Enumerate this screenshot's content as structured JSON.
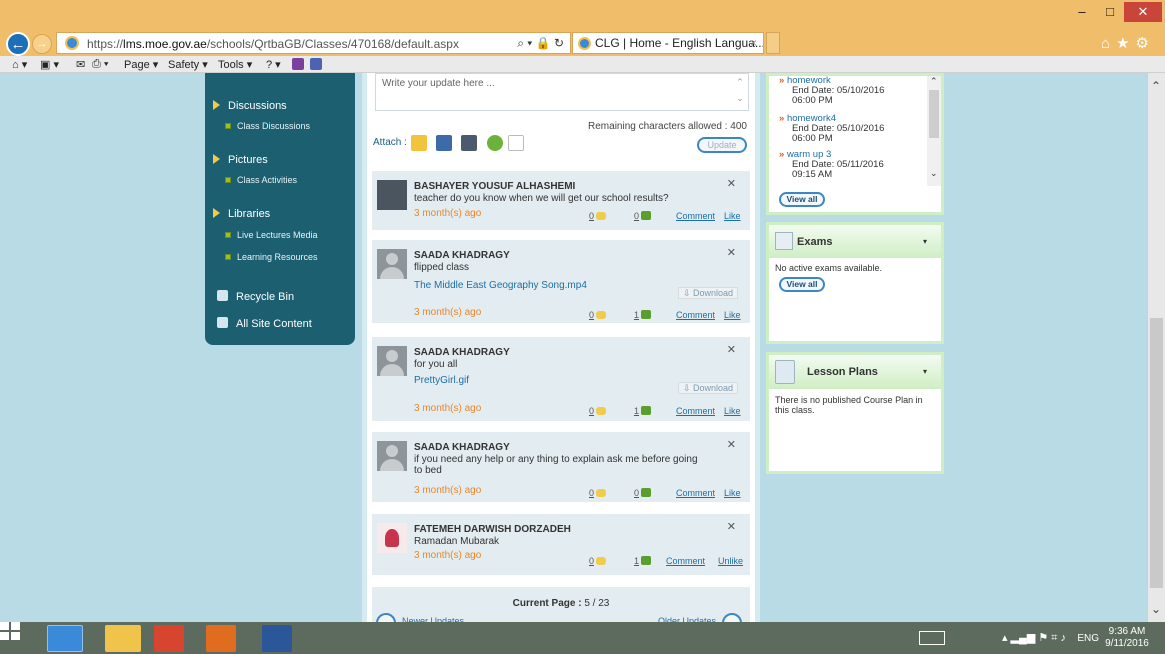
{
  "browser": {
    "url_prefix": "https://",
    "url_domain": "lms.moe.gov.ae",
    "url_path": "/schools/QrtbaGB/Classes/470168/default.aspx",
    "address_tools": "⌕ ▾ 🔒 ↻",
    "tab_title": "CLG | Home - English Langua...",
    "tab_close": "×",
    "win_min": "–",
    "win_max": "□",
    "win_close": "✕",
    "right_icons": "⌂★⚙"
  },
  "commandbar": {
    "home": "⌂ ▾",
    "feeds": "▣ ▾",
    "mail": "✉",
    "print": "⎙ ▾",
    "page": "Page ▾",
    "safety": "Safety ▾",
    "tools": "Tools ▾",
    "help": "? ▾"
  },
  "leftnav": {
    "discussions": "Discussions",
    "class_discussions": "Class Discussions",
    "pictures": "Pictures",
    "class_activities": "Class Activities",
    "libraries": "Libraries",
    "live_lectures": "Live Lectures Media",
    "learning_resources": "Learning Resources",
    "recycle_bin": "Recycle Bin",
    "all_site_content": "All Site Content"
  },
  "composer": {
    "placeholder": "Write your update here ...",
    "remaining": "Remaining characters allowed : 400",
    "attach_label": "Attach :",
    "update_button": "Update"
  },
  "posts": [
    {
      "name": "BASHAYER YOUSUF ALHASHEMI",
      "message": "teacher do you know when we will get our school results?",
      "time": "3 month(s) ago",
      "comments": "0",
      "likes": "0",
      "comment_label": "Comment",
      "like_label": "Like"
    },
    {
      "name": "SAADA KHADRAGY",
      "message": "flipped class",
      "file": "The Middle East Geography Song.mp4",
      "download": "⇩ Download",
      "time": "3 month(s) ago",
      "comments": "0",
      "likes": "1",
      "comment_label": "Comment",
      "like_label": "Like"
    },
    {
      "name": "SAADA KHADRAGY",
      "message": "for you all",
      "file": "PrettyGirl.gif",
      "download": "⇩ Download",
      "time": "3 month(s) ago",
      "comments": "0",
      "likes": "1",
      "comment_label": "Comment",
      "like_label": "Like"
    },
    {
      "name": "SAADA KHADRAGY",
      "message": "if you need any help or any thing to explain ask me before going to bed",
      "time": "3 month(s) ago",
      "comments": "0",
      "likes": "0",
      "comment_label": "Comment",
      "like_label": "Like"
    },
    {
      "name": "FATEMEH DARWISH DORZADEH",
      "message": "Ramadan Mubarak",
      "time": "3 month(s) ago",
      "comments": "0",
      "likes": "1",
      "comment_label": "Comment",
      "like_label": "Unlike"
    }
  ],
  "pager": {
    "label": "Current Page :",
    "value": "5 / 23",
    "newer": "Newer Updates",
    "older": "Older Updates"
  },
  "tasks": {
    "items": [
      {
        "title": "homework",
        "end": "End Date: 05/10/2016 06:00 PM"
      },
      {
        "title": "homework4",
        "end": "End Date: 05/10/2016 06:00 PM"
      },
      {
        "title": "warm up 3",
        "end": "End Date: 05/11/2016 09:15 AM"
      }
    ],
    "view_all": "View all"
  },
  "exams": {
    "title": "Exams",
    "message": "No active exams available.",
    "view_all": "View all"
  },
  "lesson_plans": {
    "title": "Lesson Plans",
    "message": "There is no published Course Plan in this class."
  },
  "taskbar": {
    "lang": "ENG",
    "time": "9:36 AM",
    "date": "9/11/2016",
    "tray_icons": "▴ ▂▄▆ ⚑ ⌗ ♪"
  },
  "colors": {
    "accent": "#1c5f71",
    "titlebar": "#f0bd6b",
    "page_bg": "#b9dbe6",
    "time_orange": "#e8882a"
  }
}
